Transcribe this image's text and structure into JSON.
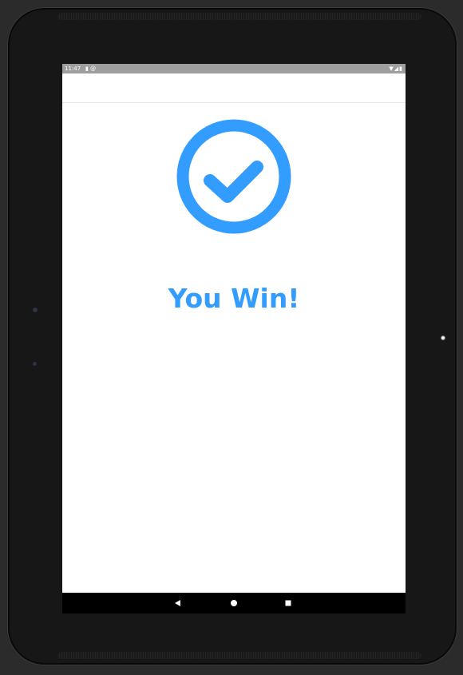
{
  "status_bar": {
    "time": "11:47",
    "left_icons": [
      "sd-card-icon",
      "at-sign-icon"
    ],
    "right_icons": [
      "wifi-icon",
      "signal-icon",
      "battery-icon"
    ]
  },
  "result": {
    "title": "You Win!",
    "icon": "check-circle-icon"
  },
  "navigation": {
    "buttons": [
      {
        "name": "back",
        "icon": "back-triangle-icon"
      },
      {
        "name": "home",
        "icon": "home-circle-icon"
      },
      {
        "name": "recents",
        "icon": "recents-square-icon"
      }
    ]
  },
  "colors": {
    "accent": "#339cff",
    "status_bar": "#9e9e9e",
    "nav_bar": "#000000",
    "background": "#ffffff",
    "device": "#171717"
  }
}
